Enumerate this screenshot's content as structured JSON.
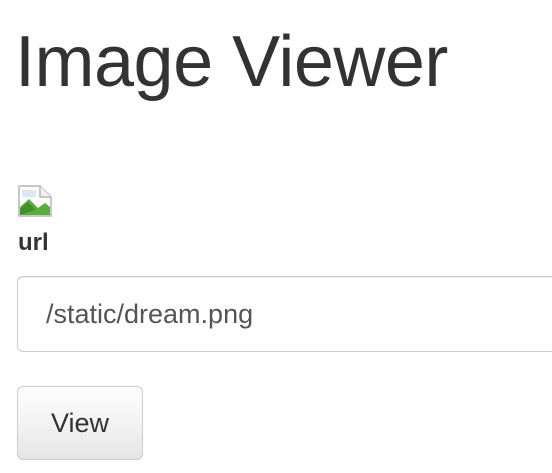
{
  "header": {
    "title": "Image Viewer"
  },
  "image": {
    "icon": "broken-image-icon"
  },
  "form": {
    "url_label": "url",
    "url_value": "/static/dream.png",
    "view_label": "View"
  }
}
